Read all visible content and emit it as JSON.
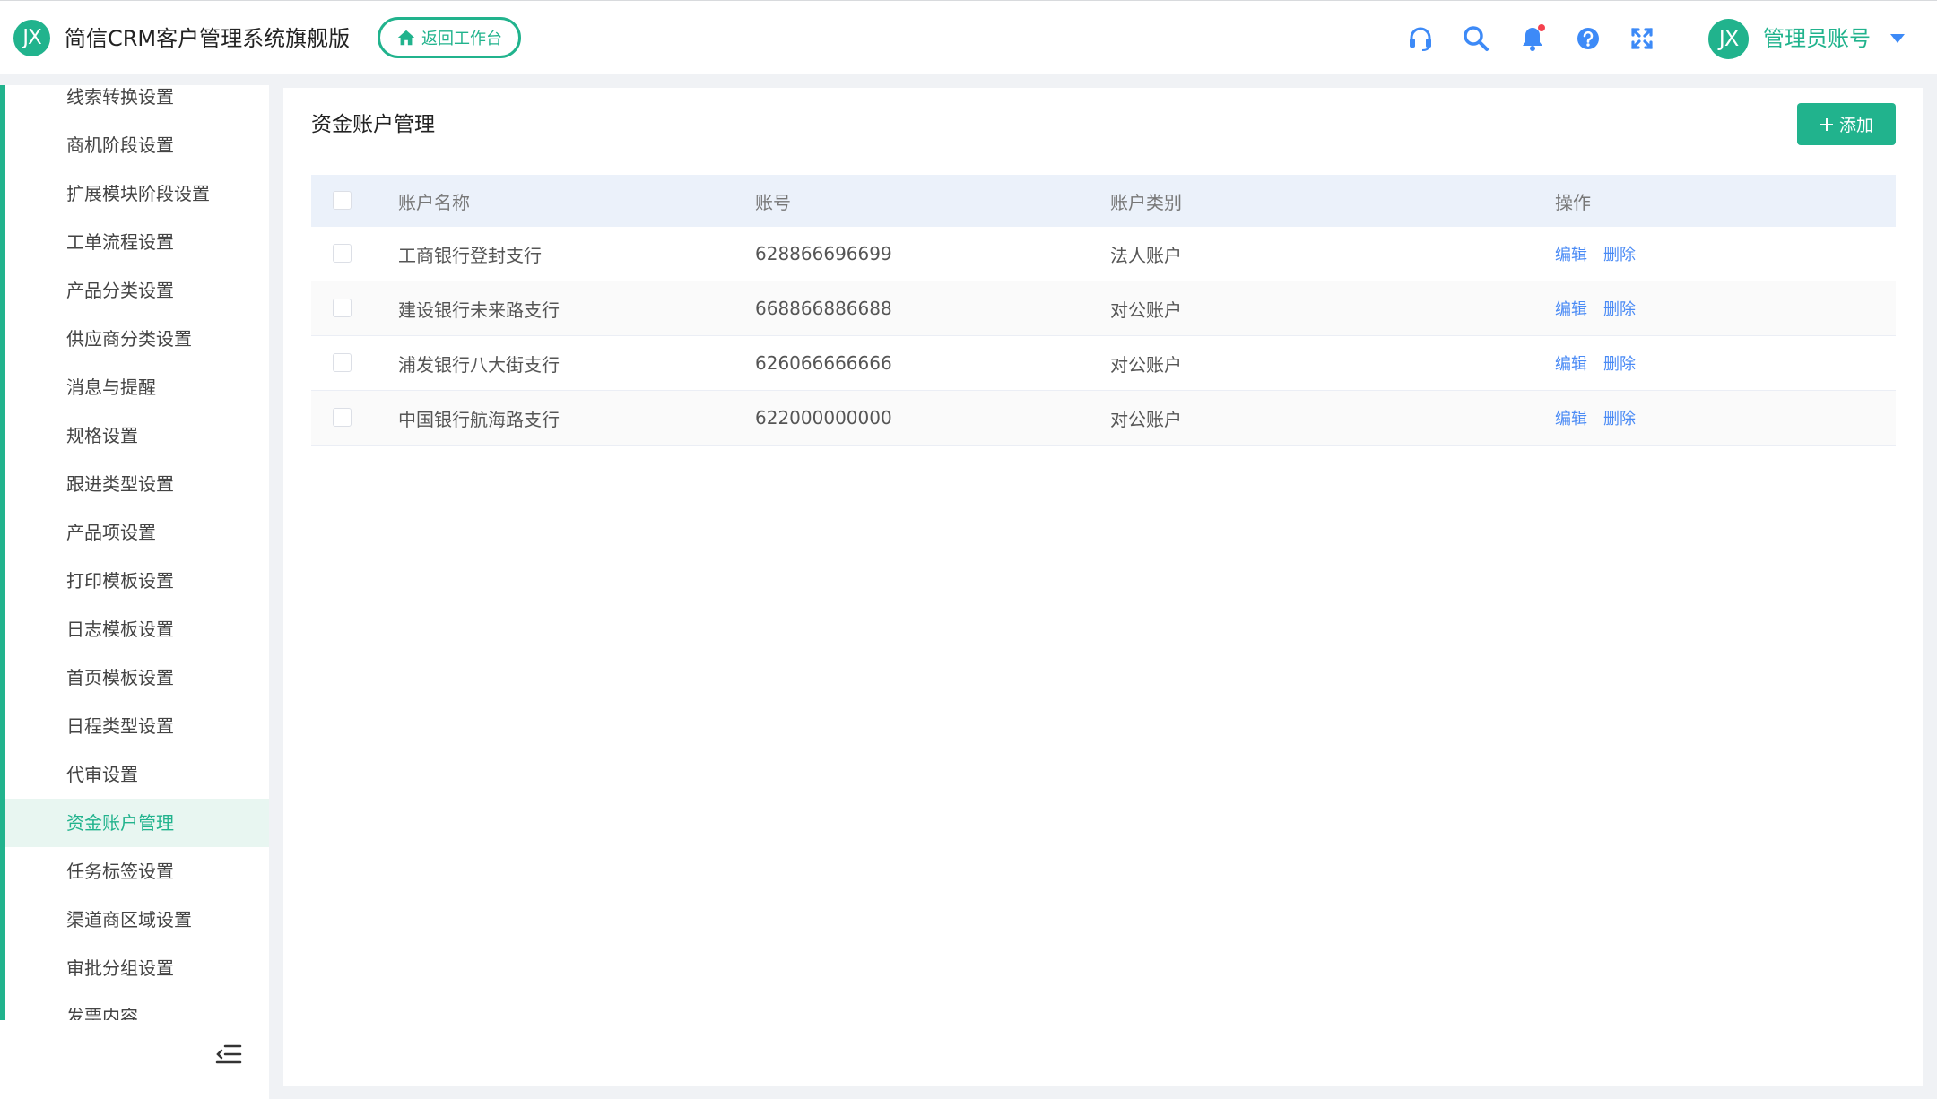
{
  "header": {
    "logo_text": "JX",
    "app_title": "简信CRM客户管理系统旗舰版",
    "back_button_label": "返回工作台",
    "user_avatar_text": "JX",
    "user_name": "管理员账号",
    "icons": [
      "headset-icon",
      "search-icon",
      "bell-icon",
      "help-icon",
      "fullscreen-icon"
    ],
    "notification_dot_color": "#f5414e"
  },
  "sidebar": {
    "items": [
      {
        "label": "线索转换设置"
      },
      {
        "label": "商机阶段设置"
      },
      {
        "label": "扩展模块阶段设置"
      },
      {
        "label": "工单流程设置"
      },
      {
        "label": "产品分类设置"
      },
      {
        "label": "供应商分类设置"
      },
      {
        "label": "消息与提醒"
      },
      {
        "label": "规格设置"
      },
      {
        "label": "跟进类型设置"
      },
      {
        "label": "产品项设置"
      },
      {
        "label": "打印模板设置"
      },
      {
        "label": "日志模板设置"
      },
      {
        "label": "首页模板设置"
      },
      {
        "label": "日程类型设置"
      },
      {
        "label": "代审设置"
      },
      {
        "label": "资金账户管理",
        "active": true
      },
      {
        "label": "任务标签设置"
      },
      {
        "label": "渠道商区域设置"
      },
      {
        "label": "审批分组设置"
      },
      {
        "label": "发票内容"
      }
    ]
  },
  "main": {
    "title": "资金账户管理",
    "add_button_label": "添加",
    "table": {
      "columns": [
        "账户名称",
        "账号",
        "账户类别",
        "操作"
      ],
      "rows": [
        {
          "name": "工商银行登封支行",
          "account": "628866696699",
          "type": "法人账户",
          "edit": "编辑",
          "delete": "删除"
        },
        {
          "name": "建设银行未来路支行",
          "account": "668866886688",
          "type": "对公账户",
          "edit": "编辑",
          "delete": "删除"
        },
        {
          "name": "浦发银行八大街支行",
          "account": "626066666666",
          "type": "对公账户",
          "edit": "编辑",
          "delete": "删除"
        },
        {
          "name": "中国银行航海路支行",
          "account": "622000000000",
          "type": "对公账户",
          "edit": "编辑",
          "delete": "删除"
        }
      ]
    }
  },
  "colors": {
    "accent": "#21b38d",
    "link": "#4b8bf5",
    "icon_blue": "#3d8af7"
  }
}
